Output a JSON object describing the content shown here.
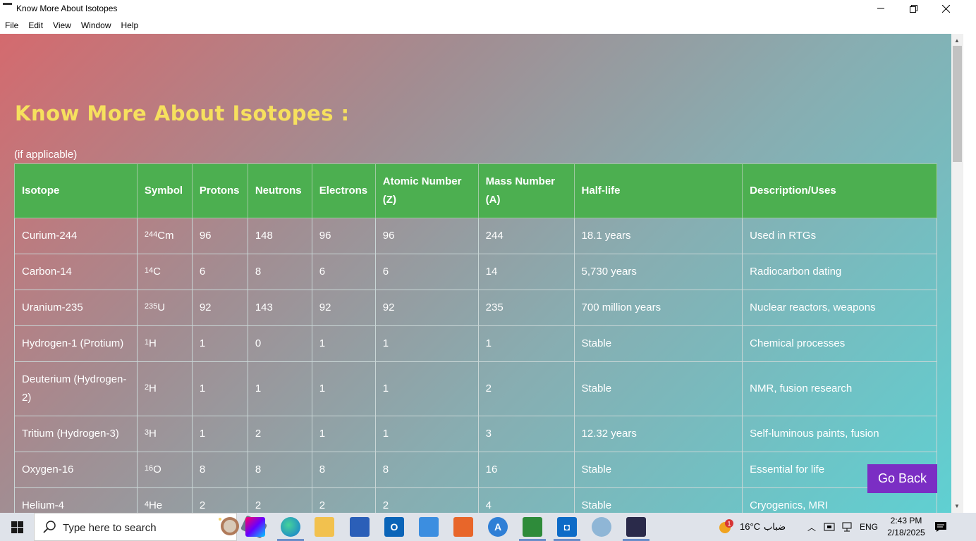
{
  "window": {
    "title": "Know More About Isotopes",
    "minimize_icon": "minimize-icon",
    "maximize_icon": "restore-icon",
    "close_icon": "close-icon"
  },
  "menu": [
    "File",
    "Edit",
    "View",
    "Window",
    "Help"
  ],
  "page": {
    "heading": "Know More About Isotopes :",
    "note": "(if applicable)",
    "heading_color": "#f6e05e",
    "header_bg": "#4caf50",
    "go_back_label": "Go Back",
    "go_back_color": "#7b2ec4"
  },
  "table": {
    "headers": [
      "Isotope",
      "Symbol",
      "Protons",
      "Neutrons",
      "Electrons",
      "Atomic Number (Z)",
      "Mass Number (A)",
      "Half-life",
      "Description/Uses"
    ],
    "rows": [
      {
        "isotope": "Curium-244",
        "sym_mass": "244",
        "sym_el": "Cm",
        "protons": "96",
        "neutrons": "148",
        "electrons": "96",
        "z": "96",
        "a": "244",
        "half_life": "18.1 years",
        "desc": "Used in RTGs"
      },
      {
        "isotope": "Carbon-14",
        "sym_mass": "14",
        "sym_el": "C",
        "protons": "6",
        "neutrons": "8",
        "electrons": "6",
        "z": "6",
        "a": "14",
        "half_life": "5,730 years",
        "desc": "Radiocarbon dating"
      },
      {
        "isotope": "Uranium-235",
        "sym_mass": "235",
        "sym_el": "U",
        "protons": "92",
        "neutrons": "143",
        "electrons": "92",
        "z": "92",
        "a": "235",
        "half_life": "700 million years",
        "desc": "Nuclear reactors, weapons"
      },
      {
        "isotope": "Hydrogen-1 (Protium)",
        "sym_mass": "1",
        "sym_el": "H",
        "protons": "1",
        "neutrons": "0",
        "electrons": "1",
        "z": "1",
        "a": "1",
        "half_life": "Stable",
        "desc": "Chemical processes"
      },
      {
        "isotope": "Deuterium (Hydrogen-2)",
        "sym_mass": "2",
        "sym_el": "H",
        "protons": "1",
        "neutrons": "1",
        "electrons": "1",
        "z": "1",
        "a": "2",
        "half_life": "Stable",
        "desc": "NMR, fusion research"
      },
      {
        "isotope": "Tritium (Hydrogen-3)",
        "sym_mass": "3",
        "sym_el": "H",
        "protons": "1",
        "neutrons": "2",
        "electrons": "1",
        "z": "1",
        "a": "3",
        "half_life": "12.32 years",
        "desc": "Self-luminous paints, fusion"
      },
      {
        "isotope": "Oxygen-16",
        "sym_mass": "16",
        "sym_el": "O",
        "protons": "8",
        "neutrons": "8",
        "electrons": "8",
        "z": "8",
        "a": "16",
        "half_life": "Stable",
        "desc": "Essential for life"
      },
      {
        "isotope": "Helium-4",
        "sym_mass": "4",
        "sym_el": "He",
        "protons": "2",
        "neutrons": "2",
        "electrons": "2",
        "z": "2",
        "a": "4",
        "half_life": "Stable",
        "desc": "Cryogenics, MRI"
      }
    ]
  },
  "taskbar": {
    "search_placeholder": "Type here to search",
    "temperature": "16°C",
    "condition": "ضباب",
    "language": "ENG",
    "time": "2:43 PM",
    "date": "2/18/2025",
    "weather_badge": "1"
  }
}
